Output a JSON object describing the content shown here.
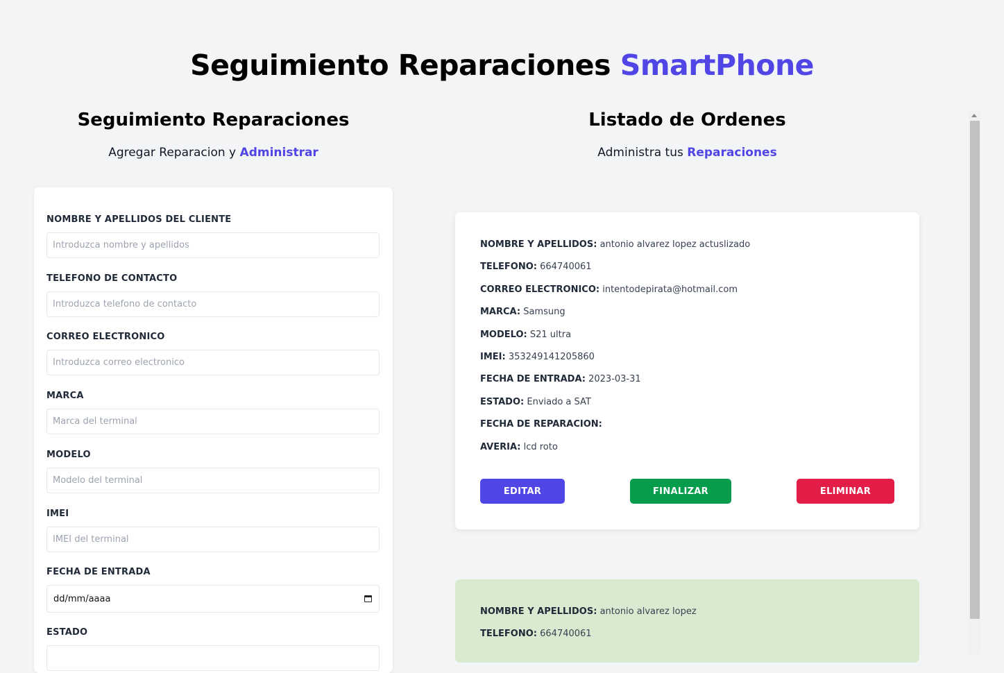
{
  "header": {
    "title_main": "Seguimiento Reparaciones",
    "title_accent": "SmartPhone"
  },
  "form_section": {
    "title": "Seguimiento Reparaciones",
    "subtitle_text": "Agregar Reparacion y",
    "subtitle_accent": "Administrar",
    "fields": [
      {
        "label": "NOMBRE Y APELLIDOS DEL CLIENTE",
        "placeholder": "Introduzca nombre y apellidos",
        "value": ""
      },
      {
        "label": "TELEFONO DE CONTACTO",
        "placeholder": "Introduzca telefono de contacto",
        "value": ""
      },
      {
        "label": "CORREO ELECTRONICO",
        "placeholder": "Introduzca correo electronico",
        "value": ""
      },
      {
        "label": "MARCA",
        "placeholder": "Marca del terminal",
        "value": ""
      },
      {
        "label": "MODELO",
        "placeholder": "Modelo del terminal",
        "value": ""
      },
      {
        "label": "IMEI",
        "placeholder": "IMEI del terminal",
        "value": ""
      },
      {
        "label": "FECHA DE ENTRADA",
        "value": "dd/mm/aaaa"
      },
      {
        "label": "ESTADO",
        "value": ""
      }
    ]
  },
  "list_section": {
    "title": "Listado de Ordenes",
    "subtitle_text": "Administra tus",
    "subtitle_accent": "Reparaciones",
    "orders": [
      {
        "background": "#ffffff",
        "rows": [
          {
            "label": "NOMBRE Y APELLIDOS:",
            "value": "antonio alvarez lopez actuslizado"
          },
          {
            "label": "TELEFONO:",
            "value": "664740061"
          },
          {
            "label": "CORREO ELECTRONICO:",
            "value": "intentodepirata@hotmail.com"
          },
          {
            "label": "MARCA:",
            "value": "Samsung"
          },
          {
            "label": "MODELO:",
            "value": "S21 ultra"
          },
          {
            "label": "IMEI:",
            "value": "353249141205860"
          },
          {
            "label": "FECHA DE ENTRADA:",
            "value": "2023-03-31"
          },
          {
            "label": "ESTADO:",
            "value": "Enviado a SAT"
          },
          {
            "label": "FECHA DE REPARACION:",
            "value": ""
          },
          {
            "label": "AVERIA:",
            "value": "lcd roto"
          }
        ],
        "buttons": {
          "edit": "EDITAR",
          "finish": "FINALIZAR",
          "delete": "ELIMINAR"
        }
      },
      {
        "background": "#d8ebd1",
        "rows": [
          {
            "label": "NOMBRE Y APELLIDOS:",
            "value": "antonio alvarez lopez"
          },
          {
            "label": "TELEFONO:",
            "value": "664740061"
          }
        ]
      }
    ]
  },
  "colors": {
    "accent": "#4f46e5",
    "background": "#f3f4f6",
    "edit_button": "#4f46e5",
    "finish_button": "#059c4b",
    "delete_button": "#e11d48",
    "finished_card": "#d8ebd1"
  }
}
